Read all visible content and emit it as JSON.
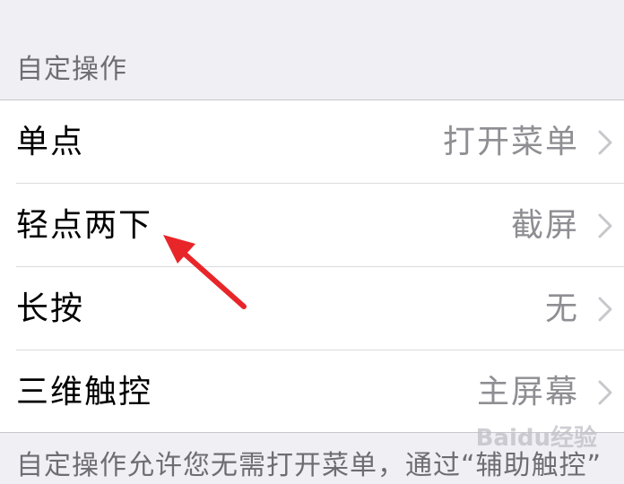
{
  "section": {
    "header": "自定操作"
  },
  "rows": [
    {
      "title": "单点",
      "value": "打开菜单"
    },
    {
      "title": "轻点两下",
      "value": "截屏"
    },
    {
      "title": "长按",
      "value": "无"
    },
    {
      "title": "三维触控",
      "value": "主屏幕"
    }
  ],
  "footer": {
    "text": "自定操作允许您无需打开菜单，通过“辅助触控”"
  },
  "watermark": {
    "text": "Baidu经验"
  },
  "colors": {
    "background": "#efeff4",
    "cell": "#ffffff",
    "value_text": "#8e8e93",
    "chevron": "#c7c7cc",
    "annotation_arrow": "#e8262a"
  },
  "icons": {
    "row_chevron": "chevron-right-icon",
    "annotation": "red-arrow-icon"
  }
}
